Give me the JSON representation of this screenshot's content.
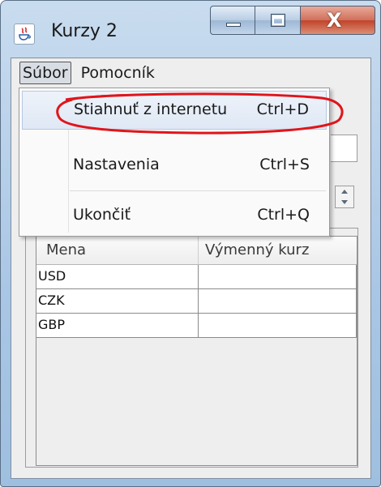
{
  "window": {
    "title": "Kurzy 2",
    "icon": "java-icon",
    "controls": {
      "minimize": "minimize-icon",
      "maximize": "maximize-icon",
      "close_glyph": "X"
    }
  },
  "menubar": {
    "items": [
      {
        "label": "Súbor",
        "active": true
      },
      {
        "label": "Pomocník",
        "active": false
      }
    ]
  },
  "file_menu": {
    "items": [
      {
        "label": "Stiahnuť z internetu",
        "shortcut": "Ctrl+D",
        "highlighted": true
      },
      {
        "label": "Nastavenia",
        "shortcut": "Ctrl+S",
        "highlighted": false
      },
      {
        "label": "Ukončiť",
        "shortcut": "Ctrl+Q",
        "highlighted": false
      }
    ]
  },
  "annotation": {
    "color": "#e0151b",
    "shape": "ellipse"
  },
  "table": {
    "columns": [
      "Mena",
      "Výmenný kurz"
    ],
    "rows": [
      [
        "USD",
        ""
      ],
      [
        "CZK",
        ""
      ],
      [
        "GBP",
        ""
      ]
    ]
  },
  "colors": {
    "frame": "#a9c6e5",
    "close_button": "#c0432a",
    "menu_highlight": "#dfe8f5"
  }
}
